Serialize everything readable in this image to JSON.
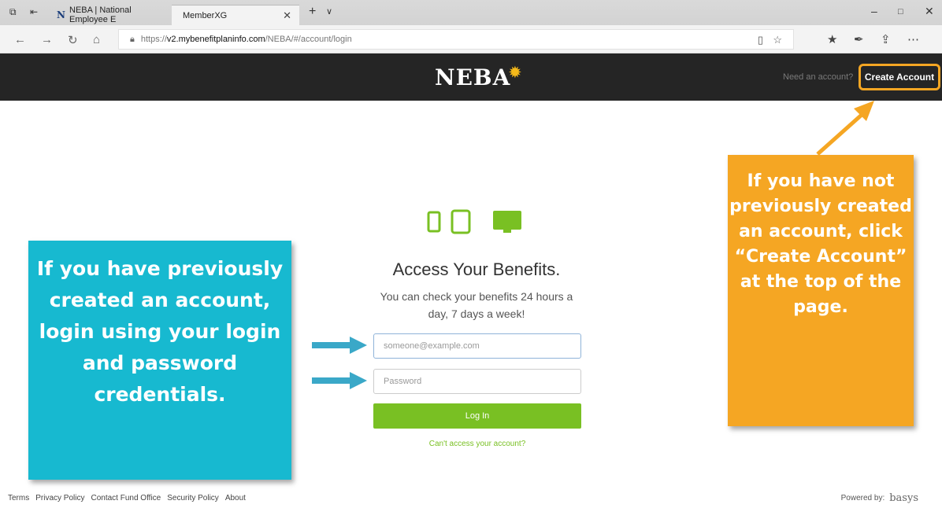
{
  "browser": {
    "tabs": [
      {
        "label": "NEBA | National Employee E",
        "favicon": "N"
      },
      {
        "label": "MemberXG"
      }
    ],
    "url_prefix": "https://",
    "url_host": "v2.mybenefitplaninfo.com",
    "url_path": "/NEBA/#/account/login"
  },
  "header": {
    "logo_text": "NEBA",
    "need_account": "Need an account?",
    "create_account": "Create Account",
    "highlight_color": "#f5a623"
  },
  "login": {
    "title": "Access Your Benefits.",
    "subtitle": "You can check your benefits 24 hours a day, 7 days a week!",
    "email_placeholder": "someone@example.com",
    "password_placeholder": "Password",
    "login_button": "Log In",
    "cant_access": "Can't access your account?",
    "accent_color": "#79c023"
  },
  "callouts": {
    "left": "If you have previously created an account, login using your login and password credentials.",
    "right": "If you have not previously created an account, click “Create Account” at the top of the page."
  },
  "footer": {
    "links": [
      "Terms",
      "Privacy Policy",
      "Contact Fund Office",
      "Security Policy",
      "About"
    ],
    "powered_by": "Powered by:",
    "brand": "basys"
  }
}
